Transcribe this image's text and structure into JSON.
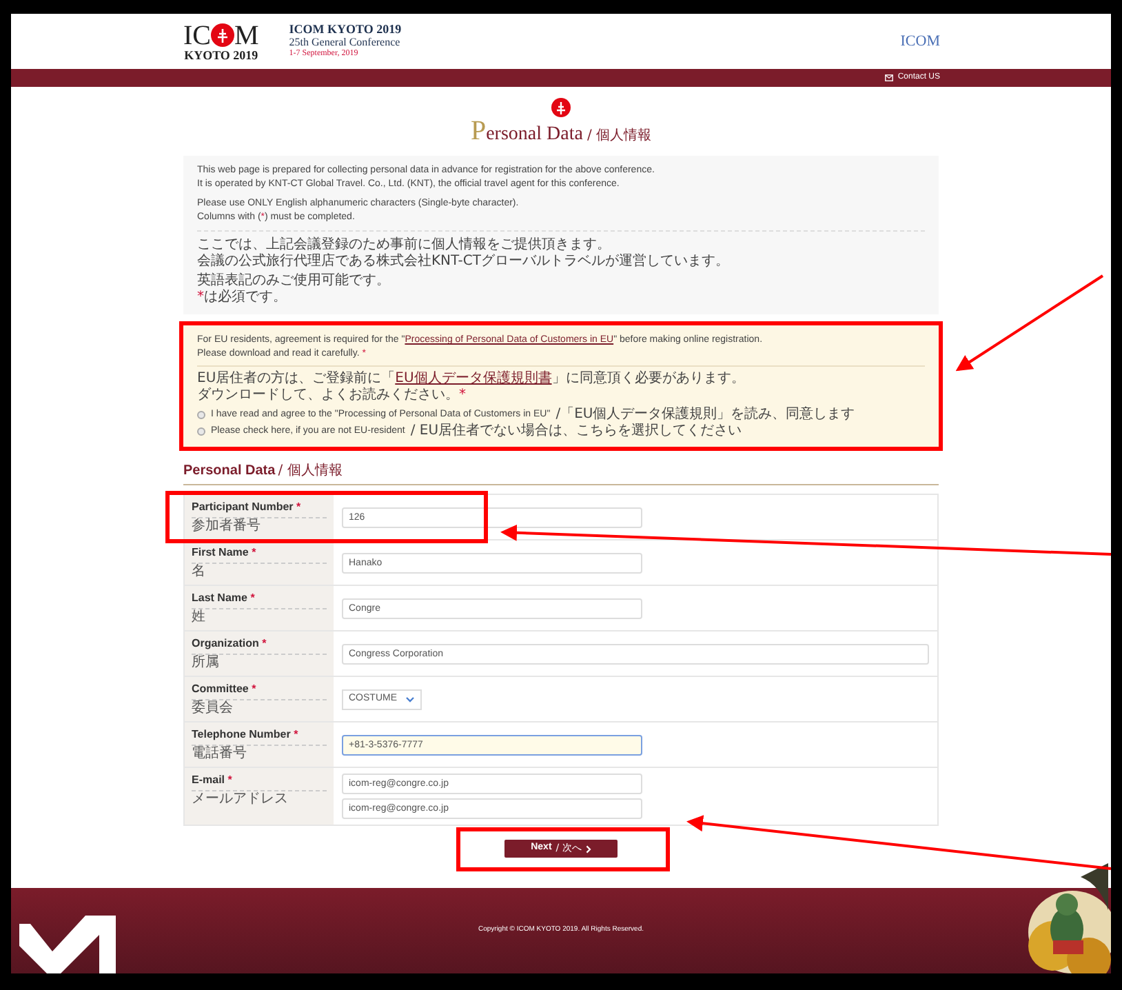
{
  "header": {
    "logo": {
      "left": "IC",
      "right": "M",
      "sub": "KYOTO 2019"
    },
    "title": "ICOM KYOTO 2019",
    "subtitle": "25th General Conference",
    "dates": "1-7 September, 2019",
    "partner_logo": "ICOM",
    "contact": "Contact US"
  },
  "page_title": {
    "initial": "P",
    "rest": "ersonal Data",
    "ja": "/ 個人情報"
  },
  "intro": {
    "en": [
      "This web page is prepared for collecting personal data in advance for registration for the above conference.",
      "It is operated by KNT-CT Global Travel. Co., Ltd. (KNT), the official travel agent for this conference."
    ],
    "rules": [
      {
        "before": "Please use ONLY English alphanumeric characters (Single-byte character)."
      },
      {
        "before": "Columns with (",
        "mark": "*",
        "after": ") must be completed."
      }
    ],
    "ja": [
      "ここでは、上記会議登録のため事前に個人情報をご提供頂きます。",
      "会議の公式旅行代理店である株式会社KNT-CTグローバルトラベルが運営しています。"
    ],
    "ja_rules": [
      {
        "before": "英語表記のみご使用可能です。"
      },
      {
        "mark": "*",
        "after": "は必須です。"
      }
    ]
  },
  "eu": {
    "line1_before": "For EU residents, agreement is required for the \"",
    "link": "Processing of Personal Data of Customers in EU",
    "line1_after": "\" before making online registration.",
    "line2": "Please download and read it carefully.",
    "mark": "*",
    "ja1_before": "EU居住者の方は、ご登録前に「",
    "ja_link": "EU個人データ保護規則書",
    "ja1_after": "」に同意頂く必要があります。",
    "ja2": "ダウンロードして、よくお読みください。",
    "options": [
      {
        "label": "I have read and agree to the \"Processing of Personal Data of Customers in EU\"",
        "label_ja": "/「EU個人データ保護規則」を読み、同意します",
        "selected": false
      },
      {
        "label": "Please check here, if you are not EU-resident",
        "label_ja": "/ EU居住者でない場合は、こちらを選択してください",
        "selected": false
      }
    ]
  },
  "section": {
    "title": "Personal Data",
    "title_ja": "/ 個人情報"
  },
  "fields": [
    {
      "kind": "short",
      "label": "Participant Number",
      "label_ja": "参加者番号",
      "required": true,
      "values": [
        "126"
      ],
      "focused": false,
      "annotated": true
    },
    {
      "kind": "short",
      "label": "First Name",
      "label_ja": "名",
      "required": true,
      "values": [
        "Hanako"
      ],
      "focused": false,
      "annotated": false
    },
    {
      "kind": "short",
      "label": "Last Name",
      "label_ja": "姓",
      "required": true,
      "values": [
        "Congre"
      ],
      "focused": false,
      "annotated": false
    },
    {
      "kind": "wide",
      "label": "Organization",
      "label_ja": "所属",
      "required": true,
      "values": [
        "Congress Corporation"
      ],
      "focused": false,
      "annotated": false
    },
    {
      "kind": "select",
      "label": "Committee",
      "label_ja": "委員会",
      "required": true,
      "values": [
        "COSTUME"
      ],
      "focused": false,
      "annotated": false
    },
    {
      "kind": "short",
      "label": "Telephone Number",
      "label_ja": "電話番号",
      "required": true,
      "values": [
        "+81-3-5376-7777"
      ],
      "focused": true,
      "annotated": false
    },
    {
      "kind": "short",
      "label": "E-mail",
      "label_ja": "メールアドレス",
      "required": true,
      "values": [
        "icom-reg@congre.co.jp",
        "icom-reg@congre.co.jp"
      ],
      "focused": false,
      "annotated": false
    }
  ],
  "next": {
    "label": "Next",
    "label_ja": "/ 次へ"
  },
  "footer": {
    "copyright": "Copyright © ICOM KYOTO 2019. All Rights Reserved."
  }
}
